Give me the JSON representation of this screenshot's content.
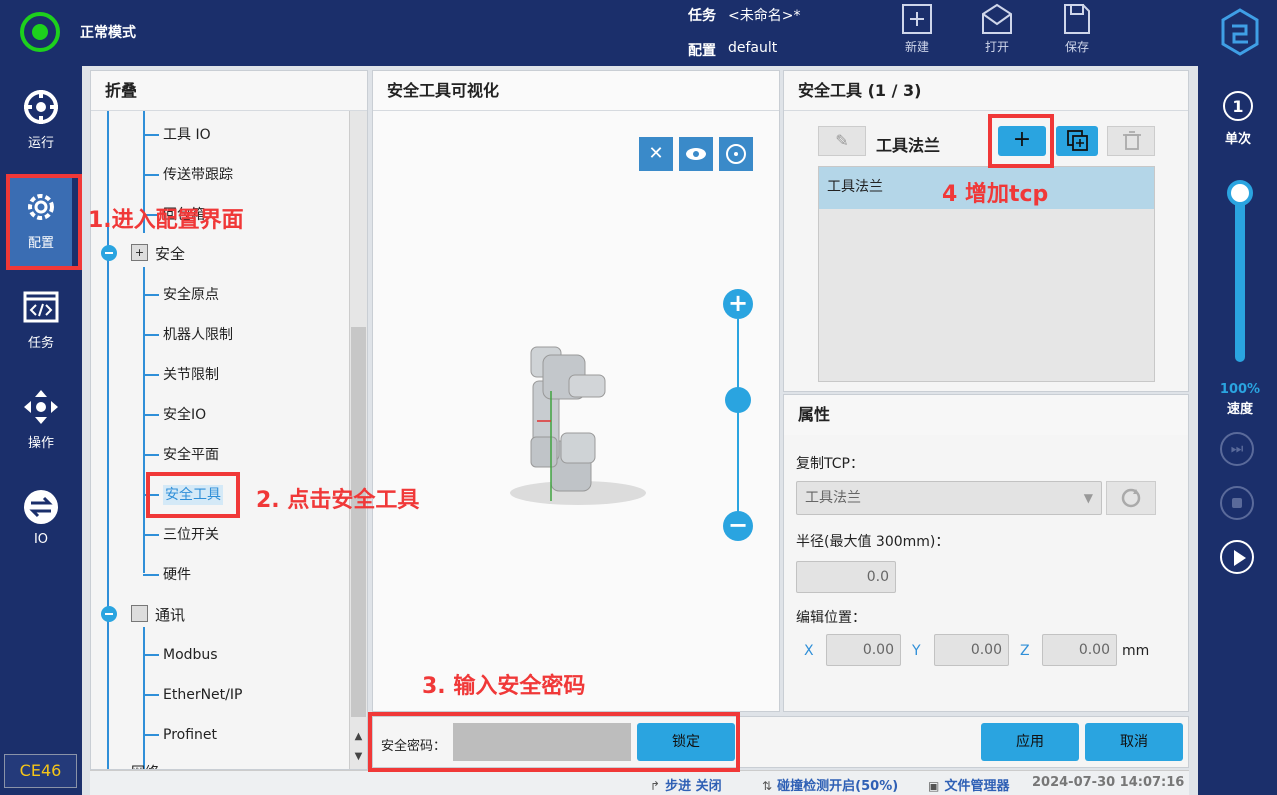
{
  "topbar": {
    "mode": "正常模式",
    "task_label": "任务",
    "task_value": "<未命名>*",
    "config_label": "配置",
    "config_value": "default",
    "new_label": "新建",
    "open_label": "打开",
    "save_label": "保存"
  },
  "leftnav": {
    "run": "运行",
    "config": "配置",
    "task": "任务",
    "operate": "操作",
    "io": "IO",
    "version": "CE46"
  },
  "tree": {
    "header": "折叠",
    "items": [
      "工具 IO",
      "传送带跟踪",
      "回包箱",
      "安全",
      "安全原点",
      "机器人限制",
      "关节限制",
      "安全IO",
      "安全平面",
      "安全工具",
      "三位开关",
      "硬件",
      "通讯",
      "Modbus",
      "EtherNet/IP",
      "Profinet",
      "网络"
    ]
  },
  "viz": {
    "header": "安全工具可视化"
  },
  "tools": {
    "header": "安全工具 (1 / 3)",
    "current": "工具法兰",
    "list": [
      "工具法兰"
    ]
  },
  "props": {
    "header": "属性",
    "copy_tcp_label": "复制TCP：",
    "copy_tcp_value": "工具法兰",
    "radius_label": "半径(最大值 300mm)：",
    "radius_value": "0.0",
    "edit_pos_label": "编辑位置：",
    "x_label": "X",
    "x_value": "0.00",
    "y_label": "Y",
    "y_value": "0.00",
    "z_label": "Z",
    "z_value": "0.00",
    "unit": "mm"
  },
  "bottom": {
    "password_label": "安全密码：",
    "lock_label": "锁定",
    "apply_label": "应用",
    "cancel_label": "取消"
  },
  "statusbar": {
    "step": "步进 关闭",
    "collision": "碰撞检测开启(50%)",
    "filemgr": "文件管理器",
    "datetime": "2024-07-30 14:07:16"
  },
  "rightbar": {
    "single": "单次",
    "speed_pct": "100%",
    "speed_label": "速度",
    "speed_level": 1.0
  },
  "annotations": {
    "a1": "1.进入配置界面",
    "a2": "2. 点击安全工具",
    "a3": "3. 输入安全密码",
    "a4": "4 增加tcp"
  },
  "colors": {
    "topbar": "#1b2f6b",
    "accent": "#2aa4e0",
    "annotation": "#f03838",
    "status_ok": "#1dd11d"
  }
}
